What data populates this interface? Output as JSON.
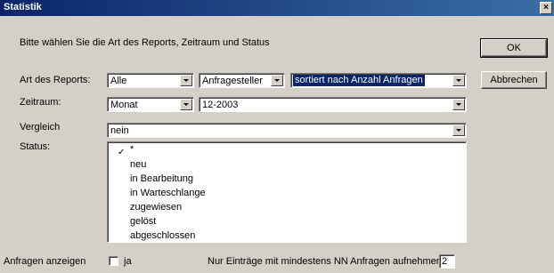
{
  "window": {
    "title": "Statistik",
    "close_glyph": "×"
  },
  "intro": "Bitte wählen Sie die Art des Reports, Zeitraum und Status",
  "buttons": {
    "ok": "OK",
    "cancel": "Abbrechen"
  },
  "labels": {
    "art": "Art des Reports:",
    "zeitraum": "Zeitraum:",
    "vergleich": "Vergleich",
    "status": "Status:",
    "anfragen_anzeigen": "Anfragen anzeigen",
    "ja": "ja",
    "nur_eintraege": "Nur Einträge mit mindestens NN Anfragen aufnehmen"
  },
  "combos": {
    "art": "Alle",
    "anfragesteller": "Anfragesteller",
    "sortierung": "sortiert nach Anzahl Anfragen",
    "zeitraum_typ": "Monat",
    "zeitraum_wert": "12-2003",
    "vergleich": "nein"
  },
  "status_items": [
    "*",
    "neu",
    "in Bearbeitung",
    "in Warteschlange",
    "zugewiesen",
    "gelöst",
    "abgeschlossen"
  ],
  "status_checkmark": "✓",
  "min_anfragen": "2",
  "anfragen_anzeigen_checked": false
}
